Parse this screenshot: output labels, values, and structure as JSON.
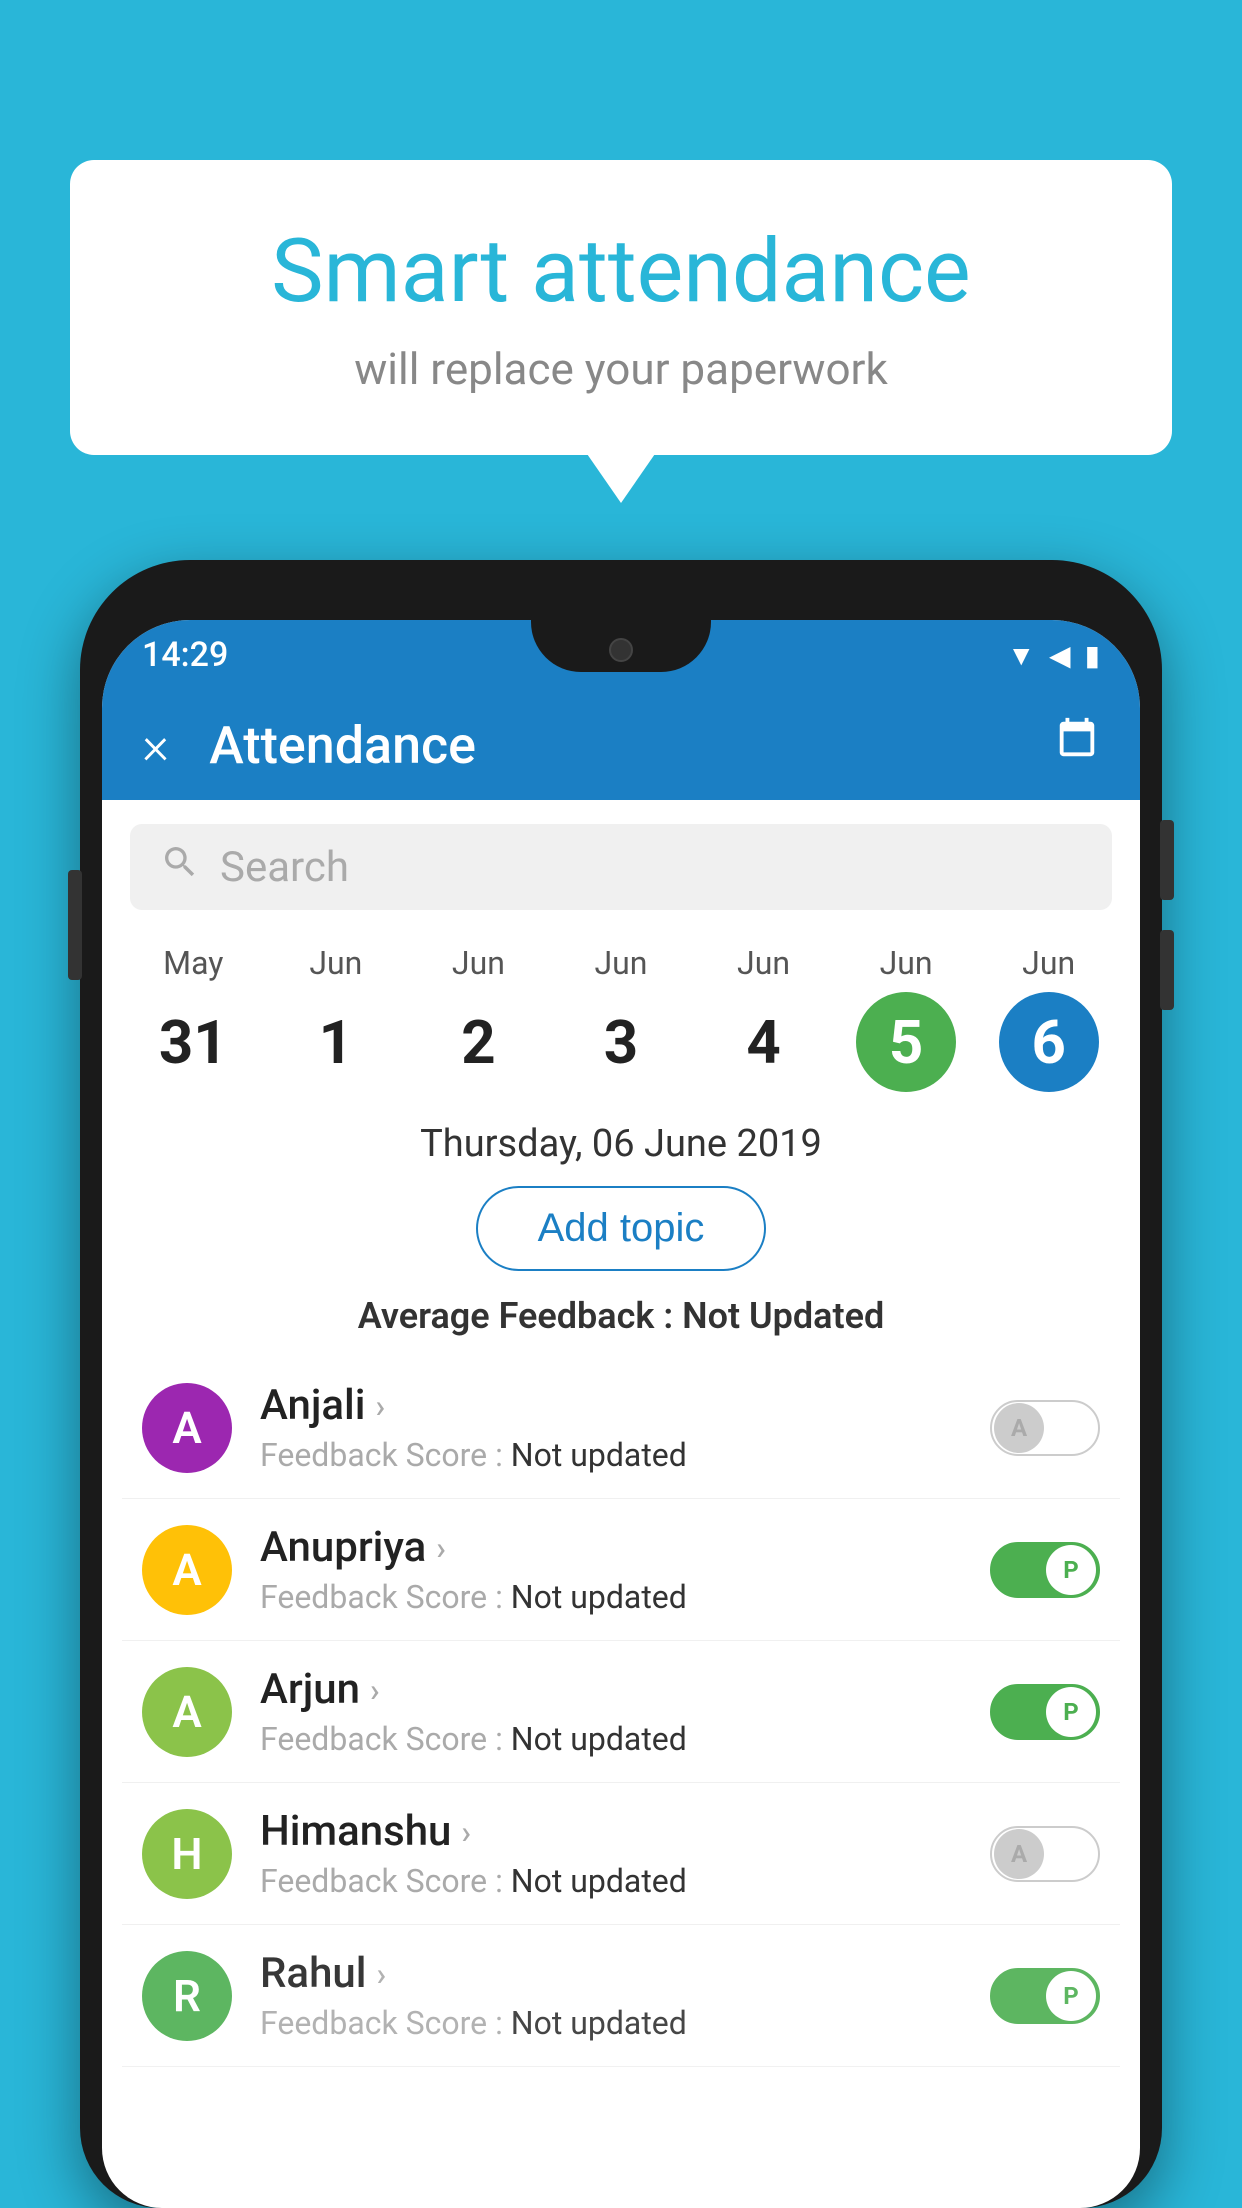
{
  "background_color": "#29b6d8",
  "speech_bubble": {
    "title": "Smart attendance",
    "subtitle": "will replace your paperwork"
  },
  "status_bar": {
    "time": "14:29",
    "icons": [
      "wifi",
      "signal",
      "battery"
    ]
  },
  "app_bar": {
    "title": "Attendance",
    "close_label": "×",
    "calendar_icon": "📅"
  },
  "search": {
    "placeholder": "Search"
  },
  "calendar": {
    "days": [
      {
        "month": "May",
        "date": "31",
        "state": "normal"
      },
      {
        "month": "Jun",
        "date": "1",
        "state": "normal"
      },
      {
        "month": "Jun",
        "date": "2",
        "state": "normal"
      },
      {
        "month": "Jun",
        "date": "3",
        "state": "normal"
      },
      {
        "month": "Jun",
        "date": "4",
        "state": "normal"
      },
      {
        "month": "Jun",
        "date": "5",
        "state": "today"
      },
      {
        "month": "Jun",
        "date": "6",
        "state": "selected"
      }
    ]
  },
  "selected_date": "Thursday, 06 June 2019",
  "add_topic_label": "Add topic",
  "average_feedback_label": "Average Feedback : ",
  "average_feedback_value": "Not Updated",
  "students": [
    {
      "name": "Anjali",
      "initial": "A",
      "avatar_color": "#9c27b0",
      "feedback_label": "Feedback Score : ",
      "feedback_value": "Not updated",
      "attendance": "absent",
      "toggle_label": "A"
    },
    {
      "name": "Anupriya",
      "initial": "A",
      "avatar_color": "#ffc107",
      "feedback_label": "Feedback Score : ",
      "feedback_value": "Not updated",
      "attendance": "present",
      "toggle_label": "P"
    },
    {
      "name": "Arjun",
      "initial": "A",
      "avatar_color": "#8bc34a",
      "feedback_label": "Feedback Score : ",
      "feedback_value": "Not updated",
      "attendance": "present",
      "toggle_label": "P"
    },
    {
      "name": "Himanshu",
      "initial": "H",
      "avatar_color": "#8bc34a",
      "feedback_label": "Feedback Score : ",
      "feedback_value": "Not updated",
      "attendance": "absent",
      "toggle_label": "A"
    },
    {
      "name": "Rahul",
      "initial": "R",
      "avatar_color": "#4caf50",
      "feedback_label": "Feedback Score : ",
      "feedback_value": "Not updated",
      "attendance": "present",
      "toggle_label": "P"
    }
  ]
}
